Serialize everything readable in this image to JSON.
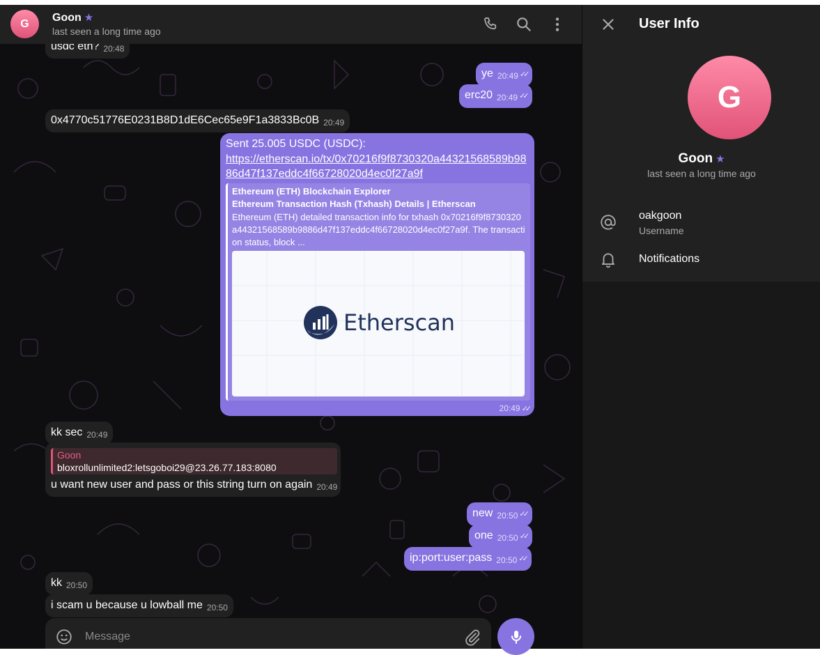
{
  "header": {
    "avatar_letter": "G",
    "name": "Goon",
    "star": "★",
    "status": "last seen a long time ago",
    "icons": [
      "phone-icon",
      "search-icon",
      "more-vertical-icon"
    ]
  },
  "messages": {
    "m0": {
      "text": "usdc eth?",
      "time": "20:48"
    },
    "m1": {
      "text": "ye",
      "time": "20:49"
    },
    "m2": {
      "text": "erc20",
      "time": "20:49"
    },
    "m3": {
      "text": "0x4770c51776E0231B8D1dE6Cec65e9F1a3833Bc0B",
      "time": "20:49"
    },
    "big": {
      "head": "Sent 25.005 USDC (USDC):",
      "link": "https://etherscan.io/tx/0x70216f9f8730320a44321568589b9886d47f137eddc4f66728020d4ec0f27a9f",
      "preview_site": "Ethereum (ETH) Blockchain Explorer",
      "preview_title": "Ethereum Transaction Hash (Txhash) Details | Etherscan",
      "preview_desc": "Ethereum (ETH) detailed transaction info for txhash 0x70216f9f8730320a44321568589b9886d47f137eddc4f66728020d4ec0f27a9f. The transaction status, block ...",
      "preview_brand": "Etherscan",
      "time": "20:49"
    },
    "m4": {
      "text": "kk sec",
      "time": "20:49"
    },
    "reply": {
      "quote_name": "Goon",
      "quote_text": "bloxrollunlimited2:letsgoboi29@23.26.77.183:8080",
      "text": "u want new user and pass or this string turn on again",
      "time": "20:49"
    },
    "m5": {
      "text": "new",
      "time": "20:50"
    },
    "m6": {
      "text": "one",
      "time": "20:50"
    },
    "m7": {
      "text": "ip:port:user:pass",
      "time": "20:50"
    },
    "m8": {
      "text": "kk",
      "time": "20:50"
    },
    "m9": {
      "text": "i scam u because u lowball me",
      "time": "20:50"
    }
  },
  "composer": {
    "placeholder": "Message"
  },
  "user_info": {
    "title": "User Info",
    "avatar_letter": "G",
    "name": "Goon",
    "star": "★",
    "status": "last seen a long time ago",
    "username": "oakgoon",
    "username_label": "Username",
    "notifications_label": "Notifications"
  },
  "colors": {
    "accent": "#8774e1",
    "avatar": "#e05378",
    "panel": "#212121"
  }
}
